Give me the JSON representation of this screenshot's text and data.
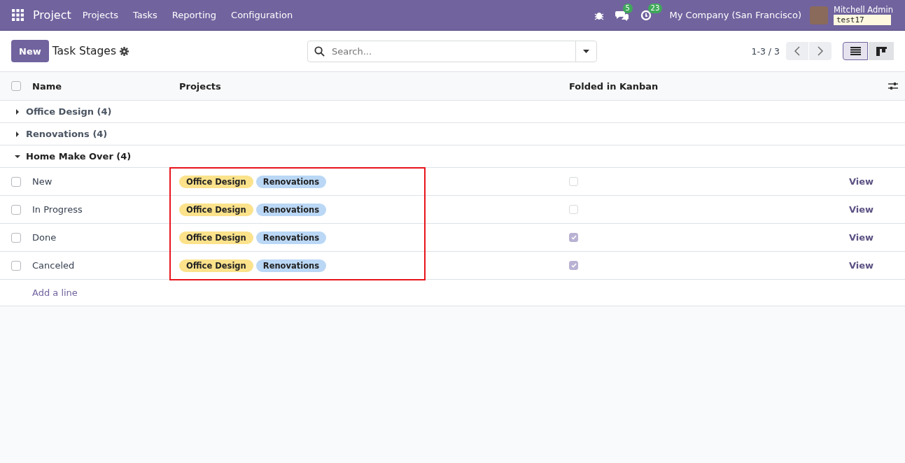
{
  "navbar": {
    "app": "Project",
    "menu": [
      "Projects",
      "Tasks",
      "Reporting",
      "Configuration"
    ],
    "messages_count": "5",
    "activities_count": "23",
    "company": "My Company (San Francisco)",
    "user": "Mitchell Admin",
    "database": "test17"
  },
  "control_panel": {
    "new_button": "New",
    "title": "Task Stages",
    "search": {
      "placeholder": "Search..."
    },
    "pager": "1-3 / 3",
    "views": [
      {
        "kind": "list",
        "selected": true
      },
      {
        "kind": "kanban",
        "selected": false
      }
    ]
  },
  "table": {
    "all_selected": false,
    "columns": [
      "Name",
      "Projects",
      "Folded in Kanban"
    ],
    "groups": [
      {
        "label": "Office Design (4)",
        "expanded": false
      },
      {
        "label": "Renovations (4)",
        "expanded": false
      },
      {
        "label": "Home Make Over (4)",
        "expanded": true,
        "rows": [
          {
            "name": "New",
            "selected": false,
            "projects": [
              {
                "label": "Office Design",
                "color": "#fbe28b"
              },
              {
                "label": "Renovations",
                "color": "#bad7f5"
              }
            ],
            "folded": false,
            "action": "View"
          },
          {
            "name": "In Progress",
            "selected": false,
            "projects": [
              {
                "label": "Office Design",
                "color": "#fbe28b"
              },
              {
                "label": "Renovations",
                "color": "#bad7f5"
              }
            ],
            "folded": false,
            "action": "View"
          },
          {
            "name": "Done",
            "selected": false,
            "projects": [
              {
                "label": "Office Design",
                "color": "#fbe28b"
              },
              {
                "label": "Renovations",
                "color": "#bad7f5"
              }
            ],
            "folded": true,
            "action": "View"
          },
          {
            "name": "Canceled",
            "selected": false,
            "projects": [
              {
                "label": "Office Design",
                "color": "#fbe28b"
              },
              {
                "label": "Renovations",
                "color": "#bad7f5"
              }
            ],
            "folded": true,
            "action": "View"
          }
        ],
        "add_line": "Add a line"
      }
    ]
  },
  "highlight": {
    "shown": true
  }
}
